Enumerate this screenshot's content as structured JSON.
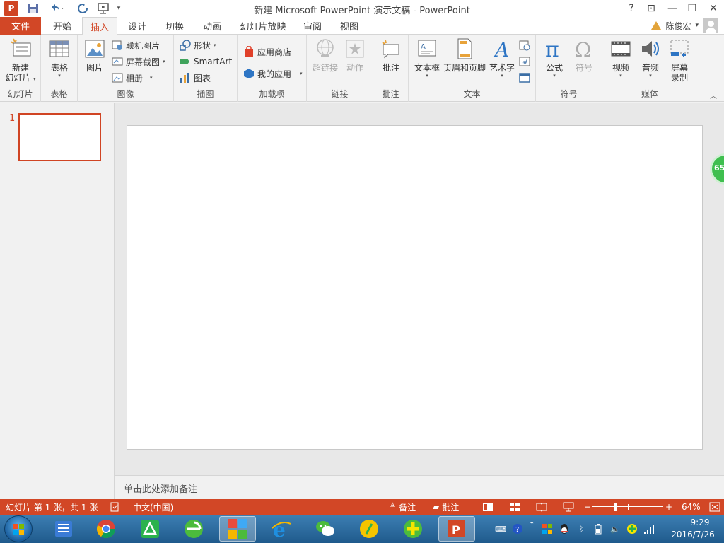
{
  "titlebar": {
    "title": "新建 Microsoft PowerPoint 演示文稿 - PowerPoint",
    "app_logo": "P",
    "help": "?",
    "ribbon_display": "⊡",
    "minimize": "—",
    "restore": "❐",
    "close": "✕"
  },
  "tabs": {
    "file": "文件",
    "items": [
      "开始",
      "插入",
      "设计",
      "切换",
      "动画",
      "幻灯片放映",
      "审阅",
      "视图"
    ],
    "active": "插入"
  },
  "user": {
    "name": "陈俊宏"
  },
  "ribbon": {
    "groups": {
      "slides": "幻灯片",
      "tables": "表格",
      "images": "图像",
      "illustrations": "插图",
      "addins": "加载项",
      "links": "链接",
      "comments": "批注",
      "text": "文本",
      "symbols": "符号",
      "media": "媒体"
    },
    "new_slide": [
      "新建",
      "幻灯片"
    ],
    "table": "表格",
    "picture": "图片",
    "online_pictures": "联机图片",
    "screenshot": "屏幕截图",
    "photo_album": "相册",
    "shapes": "形状",
    "smartart": "SmartArt",
    "chart": "图表",
    "store": "应用商店",
    "my_apps": "我的应用",
    "hyperlink": "超链接",
    "action": "动作",
    "comment": "批注",
    "textbox": "文本框",
    "header_footer": "页眉和页脚",
    "wordart": "艺术字",
    "equation": "公式",
    "symbol": "符号",
    "video": "视频",
    "audio": "音频",
    "screen_recording": [
      "屏幕",
      "录制"
    ]
  },
  "slides_pane": {
    "slide_number": "1"
  },
  "notes": {
    "placeholder": "单击此处添加备注"
  },
  "floating_badge": "65",
  "statusbar": {
    "slide_info": "幻灯片 第 1 张，共 1 张",
    "language": "中文(中国)",
    "notes": "备注",
    "comments": "批注",
    "zoom": "64%",
    "zoom_level": 0.64
  },
  "taskbar": {
    "clock_time": "9:29",
    "clock_date": "2016/7/26"
  },
  "colors": {
    "accent": "#d24726",
    "taskbar": "#2a6aa0"
  }
}
